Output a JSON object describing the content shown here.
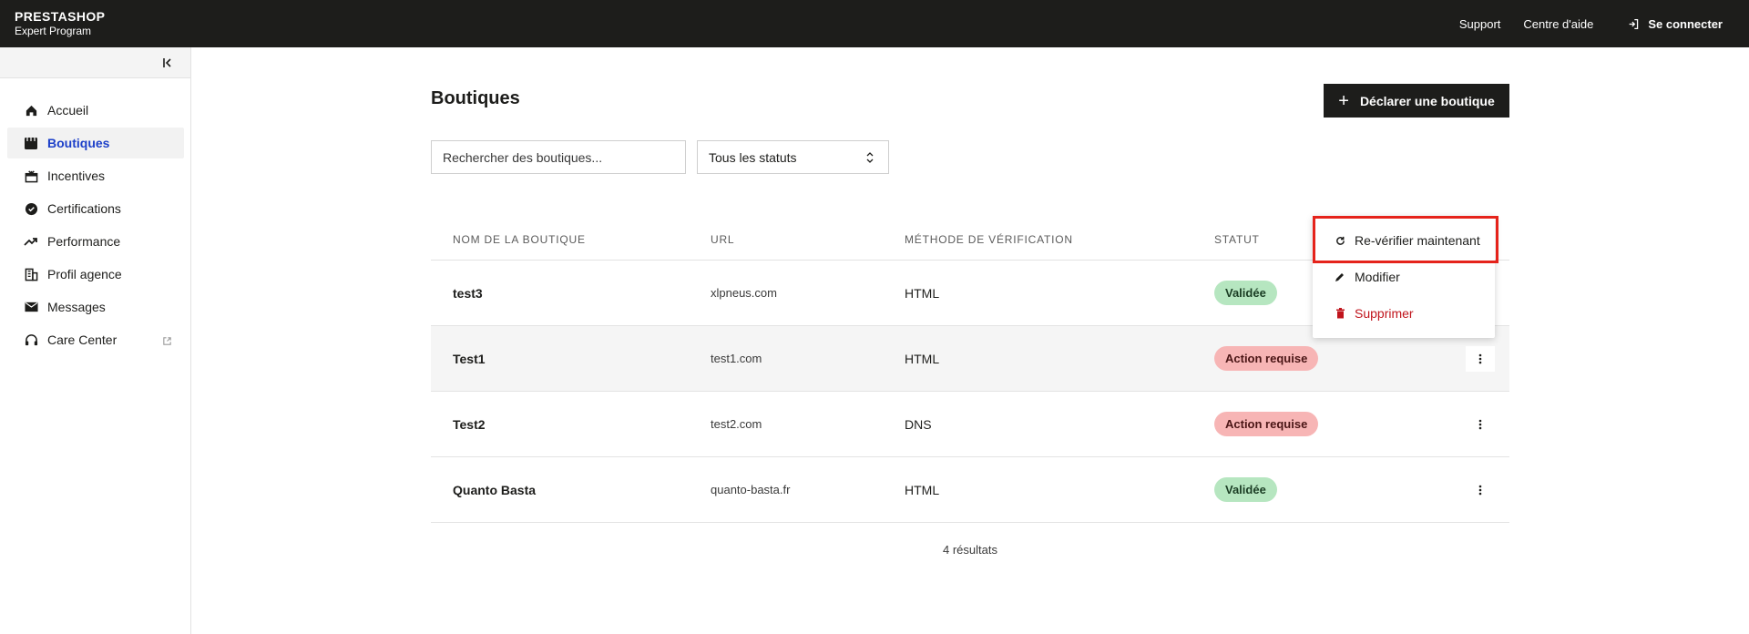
{
  "header": {
    "brand_name": "PRESTASHOP",
    "brand_sub": "Expert Program",
    "support": "Support",
    "help_center": "Centre d'aide",
    "login": "Se connecter"
  },
  "sidebar": {
    "items": [
      {
        "label": "Accueil",
        "icon": "home-icon"
      },
      {
        "label": "Boutiques",
        "icon": "store-icon"
      },
      {
        "label": "Incentives",
        "icon": "gift-icon"
      },
      {
        "label": "Certifications",
        "icon": "badge-check-icon"
      },
      {
        "label": "Performance",
        "icon": "trending-up-icon"
      },
      {
        "label": "Profil agence",
        "icon": "building-icon"
      },
      {
        "label": "Messages",
        "icon": "mail-icon"
      },
      {
        "label": "Care Center",
        "icon": "headset-icon"
      }
    ]
  },
  "main": {
    "title": "Boutiques",
    "add_button": "Déclarer une boutique",
    "search_placeholder": "Rechercher des boutiques...",
    "status_filter": "Tous les statuts",
    "columns": [
      "NOM DE LA BOUTIQUE",
      "URL",
      "MÉTHODE DE VÉRIFICATION",
      "STATUT"
    ],
    "rows": [
      {
        "name": "test3",
        "url": "xlpneus.com",
        "method": "HTML",
        "status": "Validée"
      },
      {
        "name": "Test1",
        "url": "test1.com",
        "method": "HTML",
        "status": "Action requise"
      },
      {
        "name": "Test2",
        "url": "test2.com",
        "method": "DNS",
        "status": "Action requise"
      },
      {
        "name": "Quanto Basta",
        "url": "quanto-basta.fr",
        "method": "HTML",
        "status": "Validée"
      }
    ],
    "results": "4 résultats"
  },
  "menu": {
    "recheck": "Re-vérifier maintenant",
    "edit": "Modifier",
    "delete": "Supprimer"
  },
  "colors": {
    "topbar": "#1d1d1b",
    "active_nav": "#1d40c9",
    "validated_badge": "#b6e6c0",
    "action_badge": "#f7b5b5",
    "danger": "#c0141c",
    "highlight": "#e5231b"
  }
}
